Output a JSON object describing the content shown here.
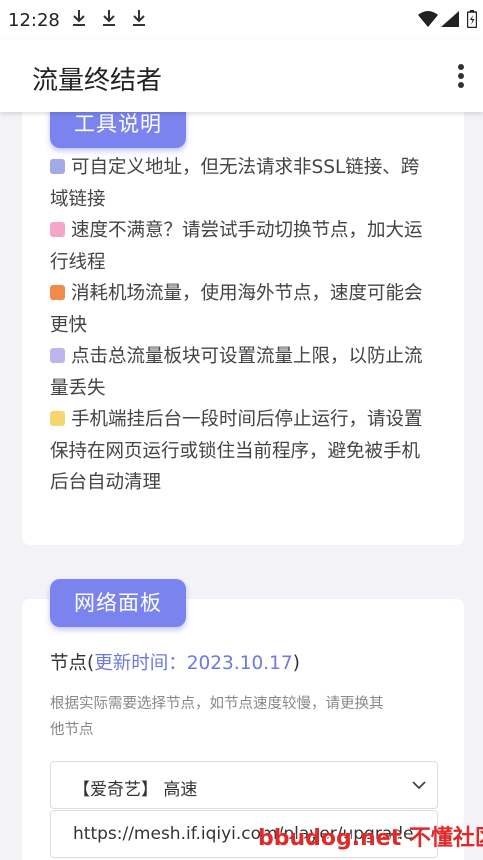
{
  "status_bar": {
    "time": "12:28",
    "download_icons": [
      "download-icon",
      "download-icon",
      "download-icon"
    ]
  },
  "app_bar": {
    "title": "流量终结者",
    "menu_icon": "more-vert-icon"
  },
  "tool_card": {
    "title": "工具说明",
    "items": [
      {
        "color": "#a3a8e6",
        "lines": [
          "可自定义地址，但无法请求非SSL链接、跨",
          "域链接"
        ]
      },
      {
        "color": "#f4a5c8",
        "lines": [
          "速度不满意？请尝试手动切换节点，加大运",
          "行线程"
        ]
      },
      {
        "color": "#f28a4a",
        "lines": [
          "消耗机场流量，使用海外节点，速度可能会",
          "更快"
        ]
      },
      {
        "color": "#bdb4ee",
        "lines": [
          "点击总流量板块可设置流量上限，以防止流",
          "量丢失"
        ]
      },
      {
        "color": "#f6d56e",
        "lines": [
          "手机端挂后台一段时间后停止运行，请设置",
          "保持在网页运行或锁住当前程序，避免被手机",
          "后台自动清理"
        ]
      }
    ]
  },
  "network_card": {
    "title": "网络面板",
    "node_label": "节点",
    "update_prefix": "更新时间：",
    "update_time": "2023.10.17",
    "hint_lines": [
      "根据实际需要选择节点，如节点速度较慢，请更换其",
      "他节点"
    ],
    "selected_node": "【爱奇艺】 高速",
    "url_value": "https://mesh.if.iqiyi.com/player/upgrade"
  },
  "watermark": "bbudog.net 不懂社区",
  "colors": {
    "accent": "#7b83ef",
    "link": "#6f79e0"
  }
}
